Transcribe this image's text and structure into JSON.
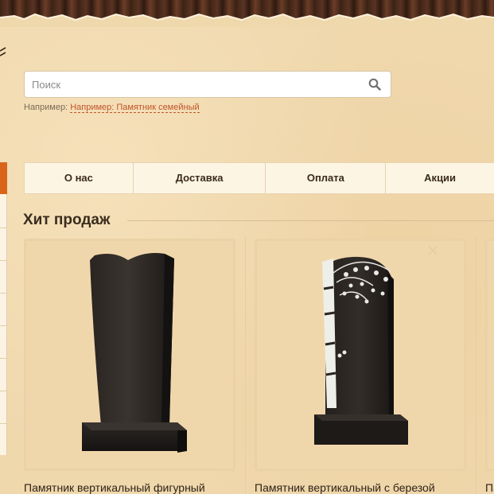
{
  "search": {
    "placeholder": "Поиск",
    "example_prefix": "Например:",
    "example_link": "Например: Памятник семейный"
  },
  "nav": {
    "items": [
      {
        "label": "О нас"
      },
      {
        "label": "Доставка"
      },
      {
        "label": "Оплата"
      },
      {
        "label": "Акции"
      }
    ]
  },
  "section": {
    "title": "Хит продаж"
  },
  "products": [
    {
      "title": "Памятник вертикальный фигурный"
    },
    {
      "title": "Памятник вертикальный с березой"
    },
    {
      "title": "Па"
    }
  ],
  "icons": {
    "search": "search-icon",
    "zoom": "zoom-icon"
  },
  "colors": {
    "accent": "#d9651b",
    "link": "#c0552a",
    "background": "#f0d9ae",
    "nav_background": "#fdf5e4"
  }
}
